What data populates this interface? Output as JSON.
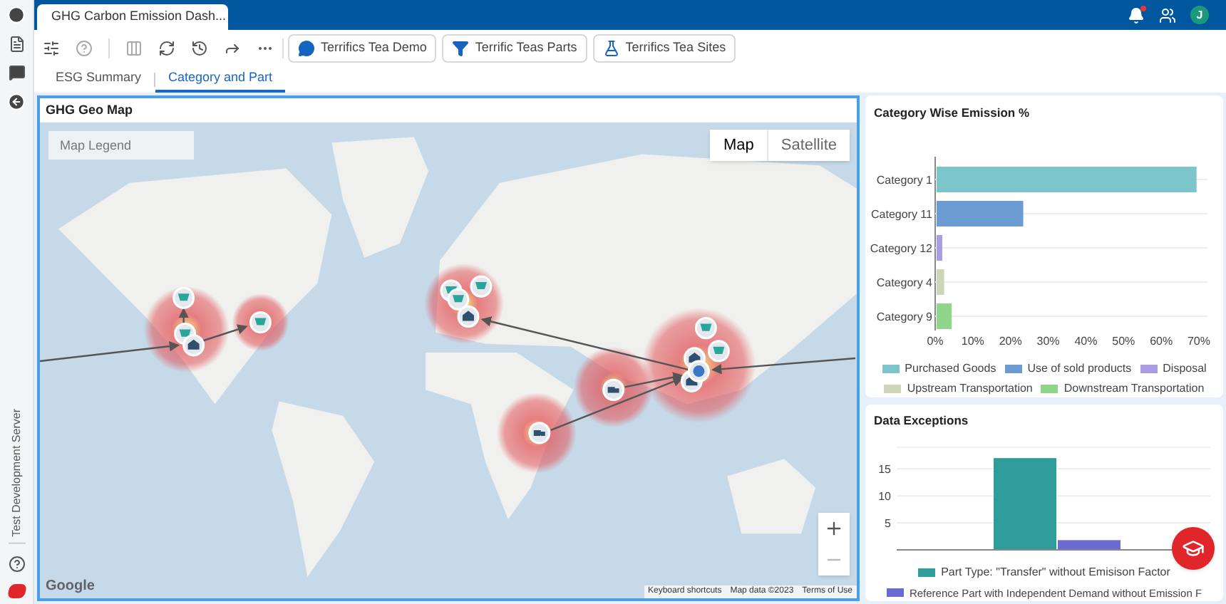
{
  "sidebar": {
    "footer_label": "Test Development Server"
  },
  "app_tab": {
    "title": "GHG Carbon Emission Dash..."
  },
  "user": {
    "initial": "J"
  },
  "toolbar": {
    "filters": [
      {
        "kind": "comment",
        "label": "Terrifics Tea Demo"
      },
      {
        "kind": "filter",
        "label": "Terrific Teas Parts"
      },
      {
        "kind": "sites",
        "label": "Terrifics Tea Sites"
      }
    ]
  },
  "tabs": [
    {
      "label": "ESG Summary",
      "selected": false
    },
    {
      "label": "Category and Part",
      "selected": true
    }
  ],
  "map_panel": {
    "title": "GHG Geo Map",
    "legend_field": {
      "placeholder": "Map Legend"
    },
    "map_types": [
      {
        "label": "Map",
        "selected": true
      },
      {
        "label": "Satellite",
        "selected": false
      }
    ],
    "logo": "Google",
    "attribution": [
      "Keyboard shortcuts",
      "Map data ©2023",
      "Terms of Use"
    ]
  },
  "emission_chart": {
    "title": "Category Wise Emission %",
    "chart_data": {
      "type": "bar",
      "orientation": "horizontal",
      "categories": [
        "Category 1",
        "Category 11",
        "Category 12",
        "Category 4",
        "Category 9"
      ],
      "series": [
        {
          "name": "Purchased Goods",
          "color": "#7cc6cb",
          "values": [
            69,
            null,
            null,
            null,
            null
          ]
        },
        {
          "name": "Use of sold products",
          "color": "#6c9bd2",
          "values": [
            null,
            23,
            null,
            null,
            null
          ]
        },
        {
          "name": "Disposal",
          "color": "#a99ce2",
          "values": [
            null,
            null,
            1.5,
            null,
            null
          ]
        },
        {
          "name": "Upstream Transportation",
          "color": "#cdd6b8",
          "values": [
            null,
            null,
            null,
            2,
            null
          ]
        },
        {
          "name": "Downstream Transportation",
          "color": "#8fd68c",
          "values": [
            null,
            null,
            null,
            null,
            4
          ]
        }
      ],
      "xlim": [
        0,
        70
      ],
      "xticks": [
        {
          "value": 0,
          "label": "0%"
        },
        {
          "value": 10,
          "label": "10%"
        },
        {
          "value": 20,
          "label": "20%"
        },
        {
          "value": 30,
          "label": "30%"
        },
        {
          "value": 40,
          "label": "40%"
        },
        {
          "value": 50,
          "label": "50%"
        },
        {
          "value": 60,
          "label": "60%"
        },
        {
          "value": 70,
          "label": "70%"
        }
      ]
    }
  },
  "exceptions_chart": {
    "title": "Data Exceptions",
    "chart_data": {
      "type": "bar",
      "series": [
        {
          "name": "Part Type: \"Transfer\" without Emisison Factor",
          "color": "#2f9c9c",
          "values": [
            17
          ]
        },
        {
          "name": "Reference Part with Independent Demand without Emission F",
          "color": "#6a6ad0",
          "values": [
            1.8
          ]
        }
      ],
      "ylim": [
        0,
        19
      ],
      "yticks": [
        5,
        10,
        15
      ],
      "grid": true
    }
  }
}
